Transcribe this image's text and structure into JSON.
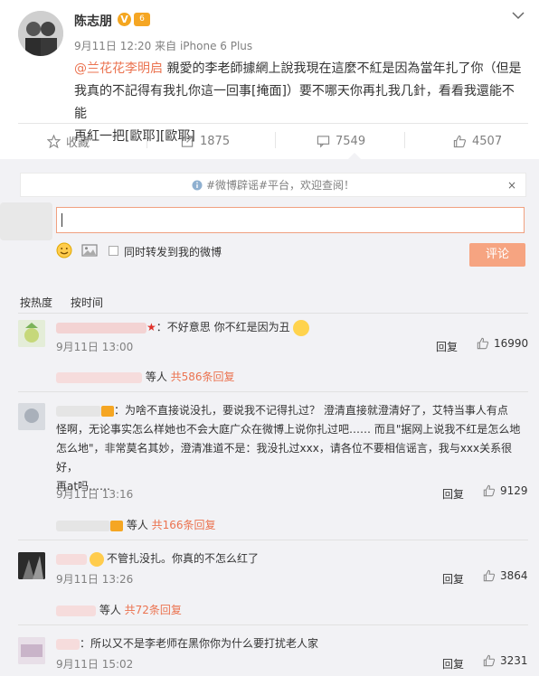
{
  "post": {
    "author": "陈志朋",
    "verified_badge": "V",
    "vip_badge": "6",
    "timestamp": "9月11日 12:20",
    "source": "来自 iPhone 6 Plus",
    "mention": "@兰花花李明启",
    "body_line1": " 親愛的李老師據網上說我現在這麼不紅是因為當年扎了你（但是",
    "body_line2": "我真的不記得有我扎你這一回事[掩面]）要不哪天你再扎我几針，看看我還能不能",
    "body_line3": "再紅一把[歐耶][歐耶]"
  },
  "actions": {
    "favorite": "收藏",
    "repost_count": "1875",
    "comment_count": "7549",
    "like_count": "4507"
  },
  "comment_box": {
    "rumor_notice": "#微博辟谣#平台，欢迎查阅！",
    "close": "×",
    "repost_label": "同时转发到我的微博",
    "submit_label": "评论"
  },
  "tabs": {
    "hot": "按热度",
    "time": "按时间"
  },
  "comments": [
    {
      "text": "：不好意思 你不红是因为丑",
      "time": "9月11日 13:00",
      "reply": "回复",
      "likes": "16990",
      "sub_people": " 等人 ",
      "sub_count": "共586条回复"
    },
    {
      "text_line1": "：为啥不直接说没扎，要说我不记得扎过？ 澄清直接就澄清好了，艾特当事人有点",
      "text_line2": "怪啊，无论事实怎么样她也不会大庭广众在微博上说你扎过吧…… 而且\"据网上说我不红是怎么地",
      "text_line3": "怎么地\"，非常莫名其妙，澄清准道不是：我没扎过xxx，请各位不要相信谣言，我与xxx关系很好，",
      "text_line4": "再at吗……",
      "time": "9月11日 13:16",
      "reply": "回复",
      "likes": "9129",
      "sub_people": " 等人 ",
      "sub_count": "共166条回复"
    },
    {
      "text": "不管扎没扎。你真的不怎么红了",
      "time": "9月11日 13:26",
      "reply": "回复",
      "likes": "3864",
      "sub_people": " 等人 ",
      "sub_count": "共72条回复"
    },
    {
      "text": "：所以又不是李老师在黑你你为什么要打扰老人家",
      "time": "9月11日 15:02",
      "reply": "回复",
      "likes": "3231"
    }
  ],
  "colors": {
    "link": "#eb7350",
    "muted": "#808080",
    "submit_bg": "#f6a481",
    "comment_bg": "#f2f2f5"
  }
}
